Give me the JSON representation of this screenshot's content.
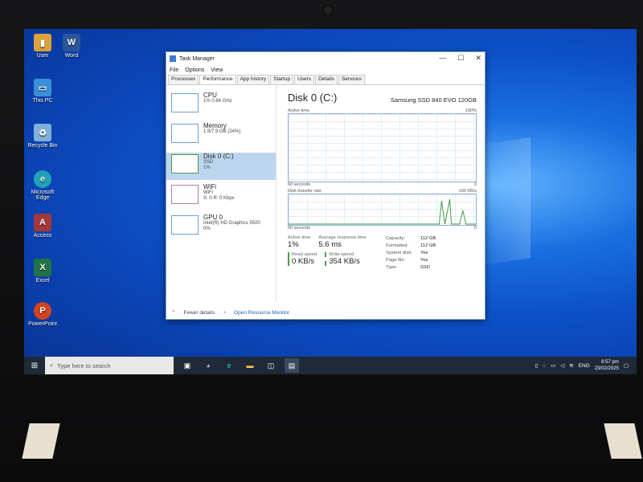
{
  "desktop": {
    "icons": [
      {
        "label": "User",
        "color": "#d9a23a",
        "glyph": "folder-icon"
      },
      {
        "label": "Word",
        "color": "#2b579a",
        "glyph": "W"
      },
      {
        "label": "This PC",
        "color": "#3a8fd9",
        "glyph": "pc-icon"
      },
      {
        "label": "Recycle Bin",
        "color": "#7fb0d8",
        "glyph": "bin-icon"
      },
      {
        "label": "Microsoft Edge",
        "color": "#1fa2b8",
        "glyph": "e"
      },
      {
        "label": "Access",
        "color": "#a4373a",
        "glyph": "A"
      },
      {
        "label": "Excel",
        "color": "#217346",
        "glyph": "X"
      },
      {
        "label": "PowerPoint",
        "color": "#d04423",
        "glyph": "P"
      }
    ]
  },
  "taskmanager": {
    "title": "Task Manager",
    "controls": {
      "minimize": "—",
      "maximize": "☐",
      "close": "✕"
    },
    "menu": [
      "File",
      "Options",
      "View"
    ],
    "tabs": [
      "Processes",
      "Performance",
      "App history",
      "Startup",
      "Users",
      "Details",
      "Services"
    ],
    "active_tab": "Performance",
    "resources": [
      {
        "name": "CPU",
        "l1": "1% 0.84 GHz",
        "l2": ""
      },
      {
        "name": "Memory",
        "l1": "1.9/7.9 GB (24%)",
        "l2": ""
      },
      {
        "name": "Disk 0 (C:)",
        "l1": "SSD",
        "l2": "1%"
      },
      {
        "name": "WiFi",
        "l1": "WiFi",
        "l2": "S: 0 R: 0 Kbps"
      },
      {
        "name": "GPU 0",
        "l1": "Intel(R) HD Graphics 5500",
        "l2": "0%"
      }
    ],
    "detail": {
      "title": "Disk 0 (C:)",
      "model": "Samsung SSD 840 EVO 120GB",
      "graph1": {
        "label": "Active time",
        "max": "100%",
        "left": "60 seconds",
        "right": "0"
      },
      "graph2": {
        "label": "Disk transfer rate",
        "max": "100 KB/s",
        "left": "60 seconds",
        "right": "0"
      },
      "stats": {
        "active_time": {
          "k": "Active time",
          "v": "1%"
        },
        "avg_response": {
          "k": "Average response time",
          "v": "5.6 ms"
        },
        "read_speed": {
          "k": "Read speed",
          "v": "0 KB/s"
        },
        "write_speed": {
          "k": "Write speed",
          "v": "354 KB/s"
        }
      },
      "props": [
        {
          "k": "Capacity:",
          "v": "112 GB"
        },
        {
          "k": "Formatted:",
          "v": "112 GB"
        },
        {
          "k": "System disk:",
          "v": "Yes"
        },
        {
          "k": "Page file:",
          "v": "Yes"
        },
        {
          "k": "Type:",
          "v": "SSD"
        }
      ]
    },
    "footer": {
      "fewer": "Fewer details",
      "monitor": "Open Resource Monitor"
    }
  },
  "taskbar": {
    "search_placeholder": "Type here to search",
    "tray_lang": "ENG",
    "time": "8:57 pm",
    "date": "23/02/2025"
  }
}
